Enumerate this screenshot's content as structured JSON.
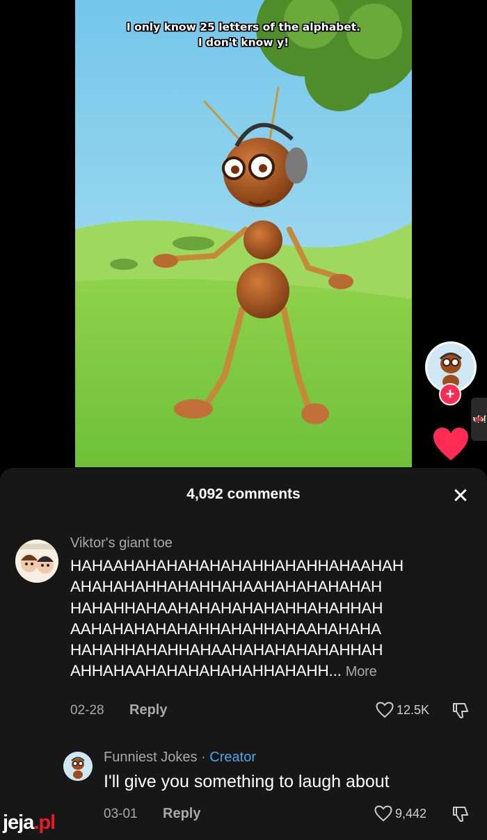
{
  "video": {
    "caption_line1": "I only know 25 letters of the alphabet.",
    "caption_line2": "I don't know y!"
  },
  "right_rail": {
    "follow_icon": "plus-icon",
    "like_icon": "heart-icon",
    "watermark_prefix": "jeja",
    "watermark_suffix": ".pl"
  },
  "comments_sheet": {
    "title": "4,092 comments",
    "close_icon": "close-icon",
    "comments": [
      {
        "username": "Viktor's giant toe",
        "text": "HAHAAHAHAHAHAHAHAHHAHAHHAHAAHAHAHAHAHAHHAHAHHAHAAHAHAHAHAHAHHAHAHHAHAAHAHAHAHAHAHAHHAHAHHAHAAHAHAHAHAHAHHAHAHHAHAAHAHAHAHAHAHHAHAHHAHAAHAHAHAHAHAHHAHHAHAHHAHAAHAHAHAHAHAHHAHAHHAHAAHAHAHAHAHAHHAH",
        "line1": "HAHAAHAHAHAHAHAHAHHAHAHHAHAAHAH",
        "line2": "AHAHAHAHHAHAHHAHAAHAHAHAHAHAH",
        "line3": "HAHAHHAHAAHAHAHAHAHAHHAHAHHAH",
        "line4": "AAHAHAHAHAHAHHAHAHHAHAAHAHAHA",
        "line5": "HAHAHHAHAHHAHAAHAHAHAHAHAHHAH",
        "line6": "AHHAHAAHAHAHAHAHAHHAHAHH...",
        "more_label": "More",
        "date": "02-28",
        "reply_label": "Reply",
        "likes": "12.5K"
      },
      {
        "username": "Funniest Jokes",
        "separator": " · ",
        "creator_label": "Creator",
        "text": "I'll give you something to laugh about",
        "date": "03-01",
        "reply_label": "Reply",
        "likes": "9,442"
      }
    ]
  },
  "brand": {
    "prefix": "jeja",
    "suffix": ".pl"
  },
  "colors": {
    "accent_red": "#fe2c55",
    "creator_blue": "#48a9e6",
    "brand_red": "#e81d1d",
    "sheet_bg": "#171717"
  }
}
